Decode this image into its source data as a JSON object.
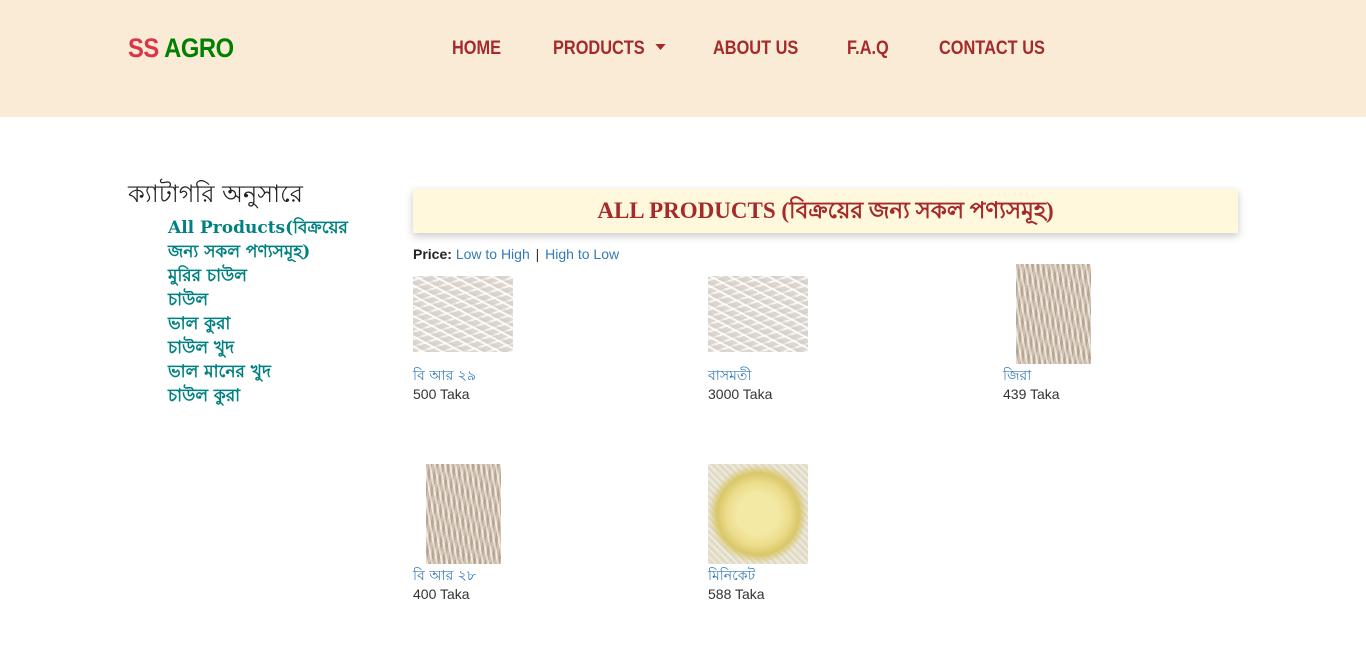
{
  "brand": {
    "part1": "SS",
    "part2": "AGRO"
  },
  "nav": {
    "home": "HOME",
    "products": "PRODUCTS",
    "about": "ABOUT US",
    "faq": "F.A.Q",
    "contact": "CONTACT US"
  },
  "sidebar": {
    "title": "ক্যাটাগরি অনুসারে",
    "items": [
      {
        "label": "All Products(বিক্রয়ের জন্য সকল পণ্যসমূহ)"
      },
      {
        "label": "মুরির চাউল"
      },
      {
        "label": "চাউল"
      },
      {
        "label": "ভাল কুরা"
      },
      {
        "label": "চাউল খুদ"
      },
      {
        "label": "ভাল মানের খুদ"
      },
      {
        "label": "চাউল কুরা"
      }
    ]
  },
  "main": {
    "heading": "ALL PRODUCTS (বিক্রয়ের জন্য সকল পণ্যসমূহ)",
    "sort": {
      "label": "Price:",
      "low_to_high": "Low to High",
      "separator": "|",
      "high_to_low": "High to Low"
    },
    "products": [
      {
        "name": "বি আর ২৯",
        "price": "500 Taka"
      },
      {
        "name": "বাসমতী",
        "price": "3000 Taka"
      },
      {
        "name": "জিরা",
        "price": "439 Taka"
      },
      {
        "name": "বি আর ২৮",
        "price": "400 Taka"
      },
      {
        "name": "মিনিকেট",
        "price": "588 Taka"
      }
    ]
  },
  "colors": {
    "header_bg": "#faebd7",
    "brand_red": "#dc3545",
    "brand_green": "#008000",
    "nav_text": "#a52a2a",
    "category_link": "#008080",
    "banner_bg": "#fff8dc",
    "link_blue": "#337ab7"
  }
}
